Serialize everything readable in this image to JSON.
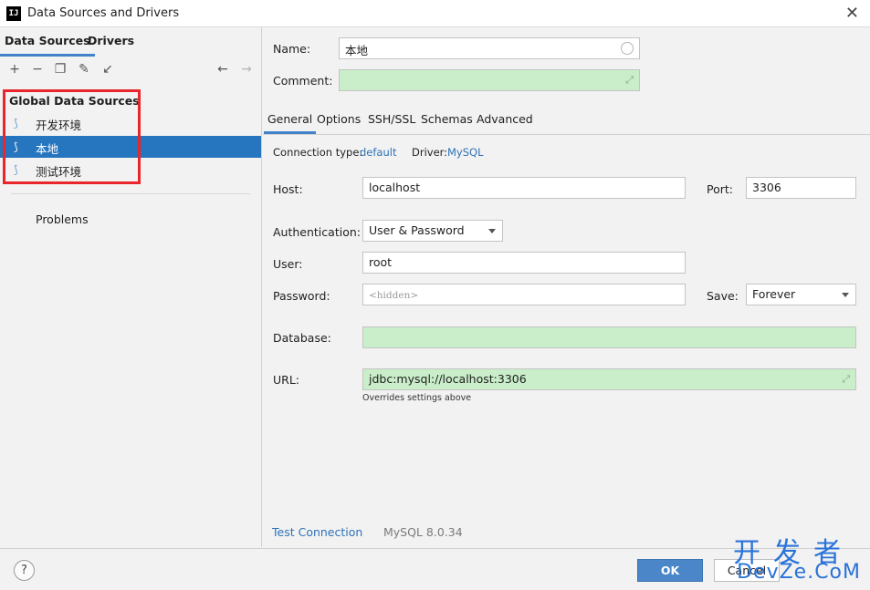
{
  "window": {
    "title": "Data Sources and Drivers",
    "app_icon": "IJ"
  },
  "left": {
    "tabs": [
      {
        "label": "Data Sources"
      },
      {
        "label": "Drivers"
      }
    ],
    "toolbar_icons": [
      "add-icon",
      "remove-icon",
      "duplicate-icon",
      "wrench-icon",
      "import-icon",
      "back-arrow-icon",
      "forward-arrow-icon"
    ],
    "tree_header": "Global Data Sources",
    "items": [
      {
        "label": "开发环境"
      },
      {
        "label": "本地"
      },
      {
        "label": "测试环境"
      }
    ],
    "problems": "Problems",
    "highlight_color": "#e8262b"
  },
  "right": {
    "name_label": "Name:",
    "name_value": "本地",
    "comment_label": "Comment:",
    "comment_value": "",
    "tabs": [
      {
        "label": "General"
      },
      {
        "label": "Options"
      },
      {
        "label": "SSH/SSL"
      },
      {
        "label": "Schemas"
      },
      {
        "label": "Advanced"
      }
    ],
    "connection_type_label": "Connection type:",
    "connection_type_value": "default",
    "driver_label": "Driver:",
    "driver_value": "MySQL",
    "host_label": "Host:",
    "host_value": "localhost",
    "port_label": "Port:",
    "port_value": "3306",
    "auth_label": "Authentication:",
    "auth_value": "User & Password",
    "user_label": "User:",
    "user_value": "root",
    "password_label": "Password:",
    "password_placeholder": "<hidden>",
    "save_label": "Save:",
    "save_value": "Forever",
    "database_label": "Database:",
    "database_value": "",
    "url_label": "URL:",
    "url_value": "jdbc:mysql://localhost:3306",
    "url_hint": "Overrides settings above",
    "test_connection": "Test Connection",
    "server_version": "MySQL 8.0.34"
  },
  "bottom": {
    "help": "?",
    "ok_label": "OK",
    "cancel_label": "Cancel"
  },
  "watermark": {
    "top": "开发者",
    "bottom": "DevZe.CoM"
  },
  "colors": {
    "accent": "#2675bf",
    "link": "#2f72b8",
    "green_field": "#c9eec9",
    "ok_button": "#4a86c8"
  }
}
